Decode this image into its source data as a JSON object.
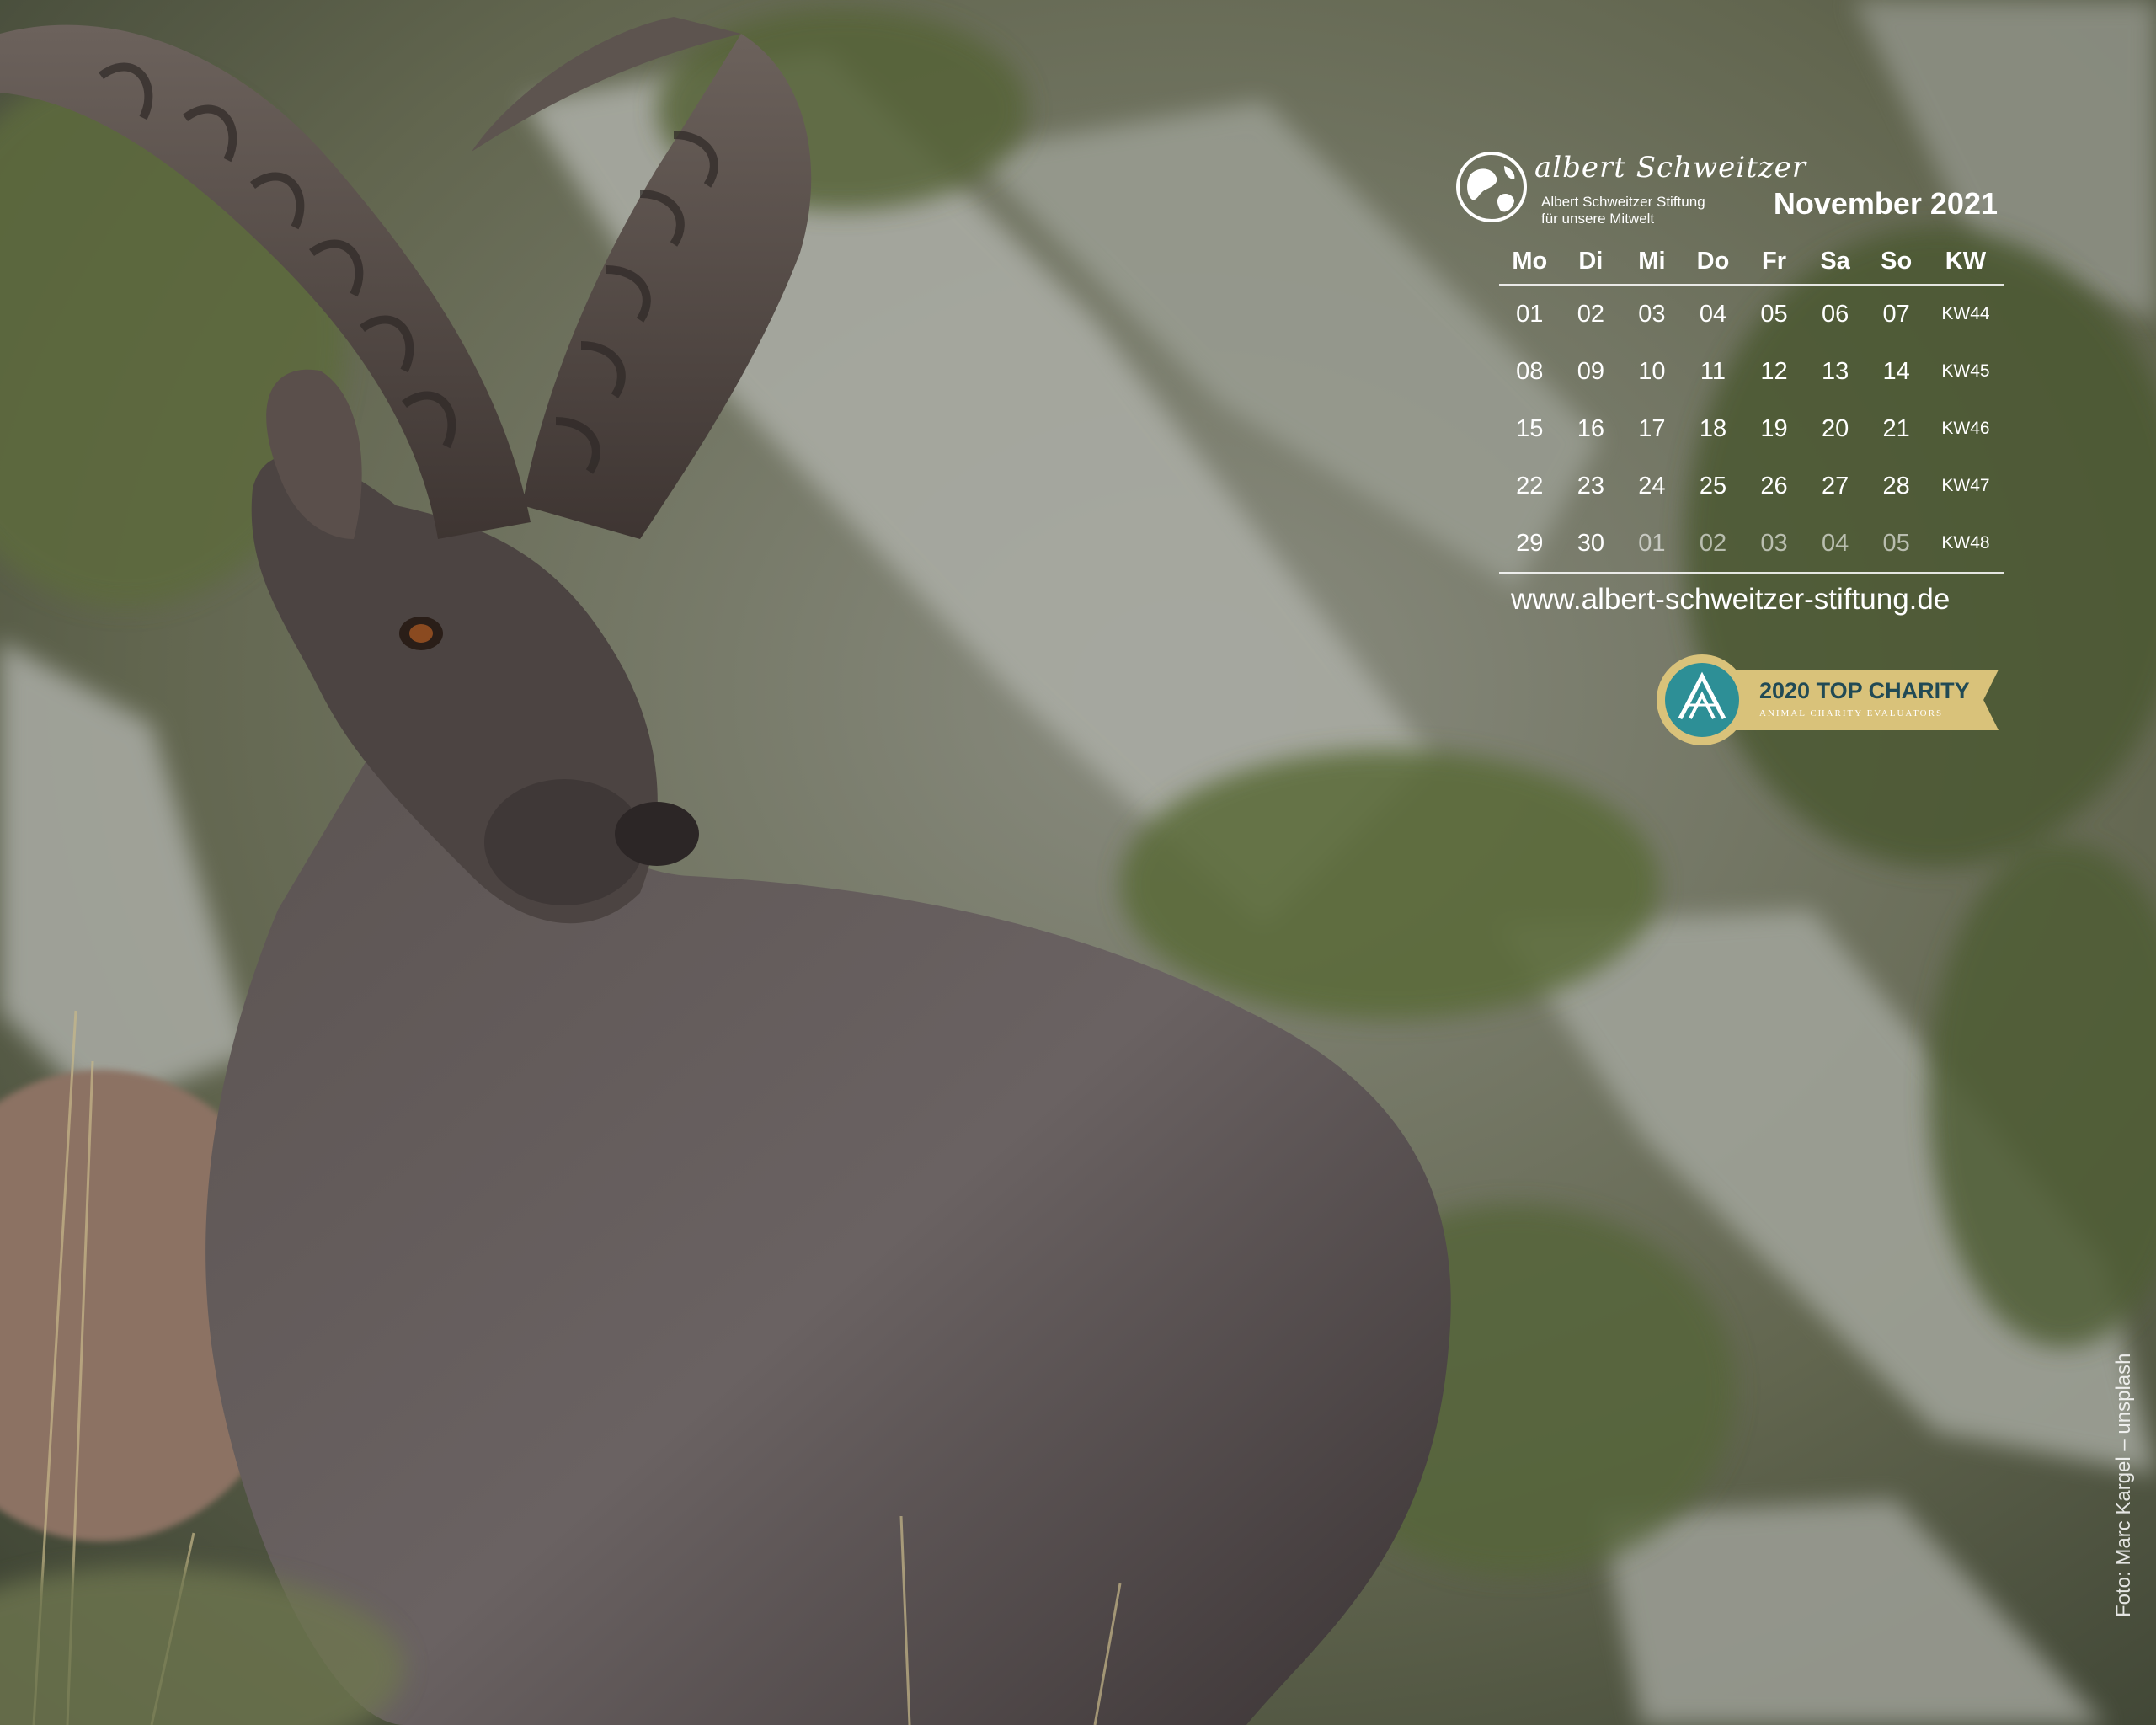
{
  "photo": {
    "subject_icon": "ibex-photo"
  },
  "logo": {
    "script": "albert Schweitzer",
    "name": "Albert Schweitzer Stiftung",
    "tagline": "für unsere Mitwelt",
    "icon": "globe-icon"
  },
  "calendar": {
    "title": "November 2021",
    "headers": [
      "Mo",
      "Di",
      "Mi",
      "Do",
      "Fr",
      "Sa",
      "So",
      "KW"
    ],
    "weeks": [
      {
        "days": [
          "01",
          "02",
          "03",
          "04",
          "05",
          "06",
          "07"
        ],
        "kw": "KW44",
        "other_from": 7
      },
      {
        "days": [
          "08",
          "09",
          "10",
          "11",
          "12",
          "13",
          "14"
        ],
        "kw": "KW45",
        "other_from": 7
      },
      {
        "days": [
          "15",
          "16",
          "17",
          "18",
          "19",
          "20",
          "21"
        ],
        "kw": "KW46",
        "other_from": 7
      },
      {
        "days": [
          "22",
          "23",
          "24",
          "25",
          "26",
          "27",
          "28"
        ],
        "kw": "KW47",
        "other_from": 7
      },
      {
        "days": [
          "29",
          "30",
          "01",
          "02",
          "03",
          "04",
          "05"
        ],
        "kw": "KW48",
        "other_from": 2
      }
    ]
  },
  "website": "www.albert-schweitzer-stiftung.de",
  "badge": {
    "title": "2020 TOP CHARITY",
    "subtitle": "ANIMAL CHARITY EVALUATORS",
    "colors": {
      "ribbon": "#d9c27a",
      "circle": "#2d8f96",
      "text": "#214a55"
    }
  },
  "credit": "Foto: Marc Kargel – unsplash"
}
